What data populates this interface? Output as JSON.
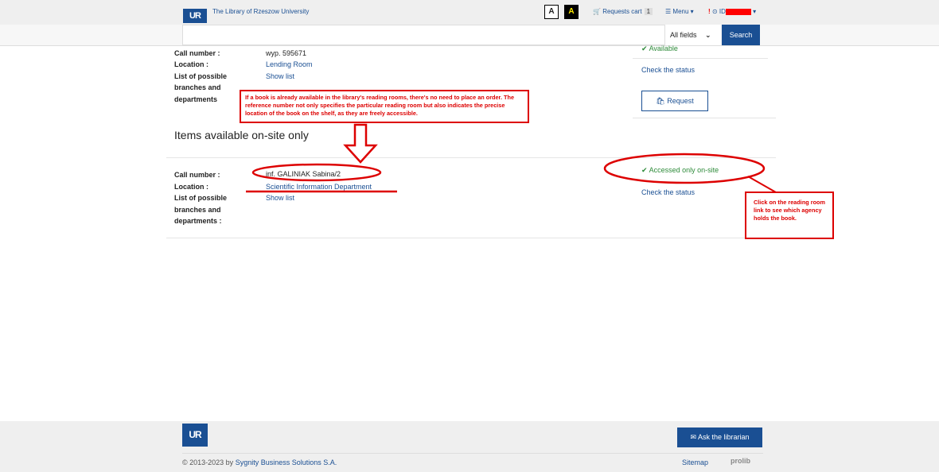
{
  "header": {
    "logo": "UR",
    "library_name": "The Library of Rzeszow University",
    "contrast_normal": "A",
    "contrast_high": "A",
    "cart_label": "Requests cart",
    "cart_count": "1",
    "menu_label": "Menu",
    "user_label": "ID"
  },
  "search": {
    "placeholder": "",
    "field_select": "All fields",
    "button": "Search"
  },
  "item1": {
    "call_number_label": "Call number :",
    "call_number": "wyp. 595671",
    "location_label": "Location :",
    "location": "Lending Room",
    "branches_label_1": "List of possible",
    "branches_label_2": "branches and",
    "branches_label_3": "departments",
    "show_list": "Show list",
    "status": "Available",
    "check_status": "Check the status",
    "request_button": "Request"
  },
  "section_title": "Items available on-site only",
  "item2": {
    "call_number_label": "Call number :",
    "call_number": "inf. GALINIAK Sabina/2",
    "location_label": "Location :",
    "location": "Scientific Information Department",
    "branches_label_1": "List of possible",
    "branches_label_2": "branches and",
    "branches_label_3": "departments :",
    "show_list": "Show list",
    "status": "Accessed only on-site",
    "check_status": "Check the status"
  },
  "annotations": {
    "note1": "If a book is already available in the library's reading rooms, there's no need to place an order. The reference number not only specifies the particular reading room but also indicates the precise location of the book on the shelf, as they are freely accessible.",
    "note2": "Click on the reading room link to see which agency holds the book."
  },
  "footer": {
    "logo": "UR",
    "ask_button": "Ask the librarian",
    "copyright_prefix": "© 2013-2023 by ",
    "copyright_company": "Sygnity Business Solutions S.A.",
    "sitemap": "Sitemap",
    "prolib": "prolib"
  },
  "colors": {
    "brand": "#1a4f93",
    "available": "#2e8b3a",
    "annotation": "#dd0000"
  }
}
